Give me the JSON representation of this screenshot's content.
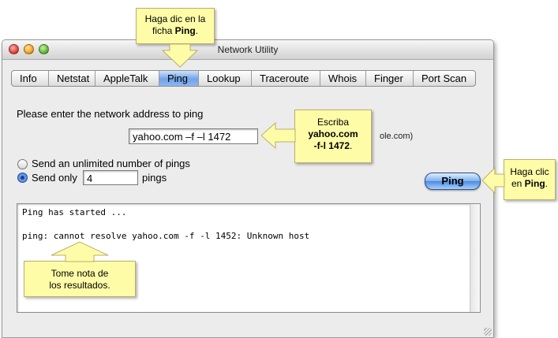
{
  "window": {
    "title": "Network Utility"
  },
  "tabs": [
    {
      "label": "Info"
    },
    {
      "label": "Netstat"
    },
    {
      "label": "AppleTalk"
    },
    {
      "label": "Ping",
      "active": true
    },
    {
      "label": "Lookup"
    },
    {
      "label": "Traceroute"
    },
    {
      "label": "Whois"
    },
    {
      "label": "Finger"
    },
    {
      "label": "Port Scan"
    }
  ],
  "ping": {
    "prompt": "Please enter the network address to ping",
    "address_value": "yahoo.com –f –l 1472",
    "hint_fragment": "ole.com)",
    "option_unlimited": "Send an unlimited number of pings",
    "option_only": "Send only",
    "count_value": "4",
    "count_suffix": "pings",
    "button_label": "Ping"
  },
  "output": {
    "lines": [
      "Ping has started ...",
      "",
      "ping: cannot resolve yahoo.com -f -l 1452: Unknown host"
    ]
  },
  "callouts": {
    "tab": {
      "line1": "Haga dic en la",
      "line2_pre": "ficha ",
      "line2_bold": "Ping",
      "line2_post": "."
    },
    "type": {
      "line1": "Escriba",
      "line2": "yahoo.com",
      "line3": "-f-l 1472",
      "line3_post": "."
    },
    "button": {
      "line1": "Haga clic",
      "line2_pre": "en ",
      "line2_bold": "Ping",
      "line2_post": "."
    },
    "results": {
      "line1": "Tome nota de",
      "line2": "los resultados."
    }
  },
  "colors": {
    "callout_bg": "#fffca8",
    "tab_active": "#6fa3e8",
    "button_blue": "#4b8ae0"
  }
}
